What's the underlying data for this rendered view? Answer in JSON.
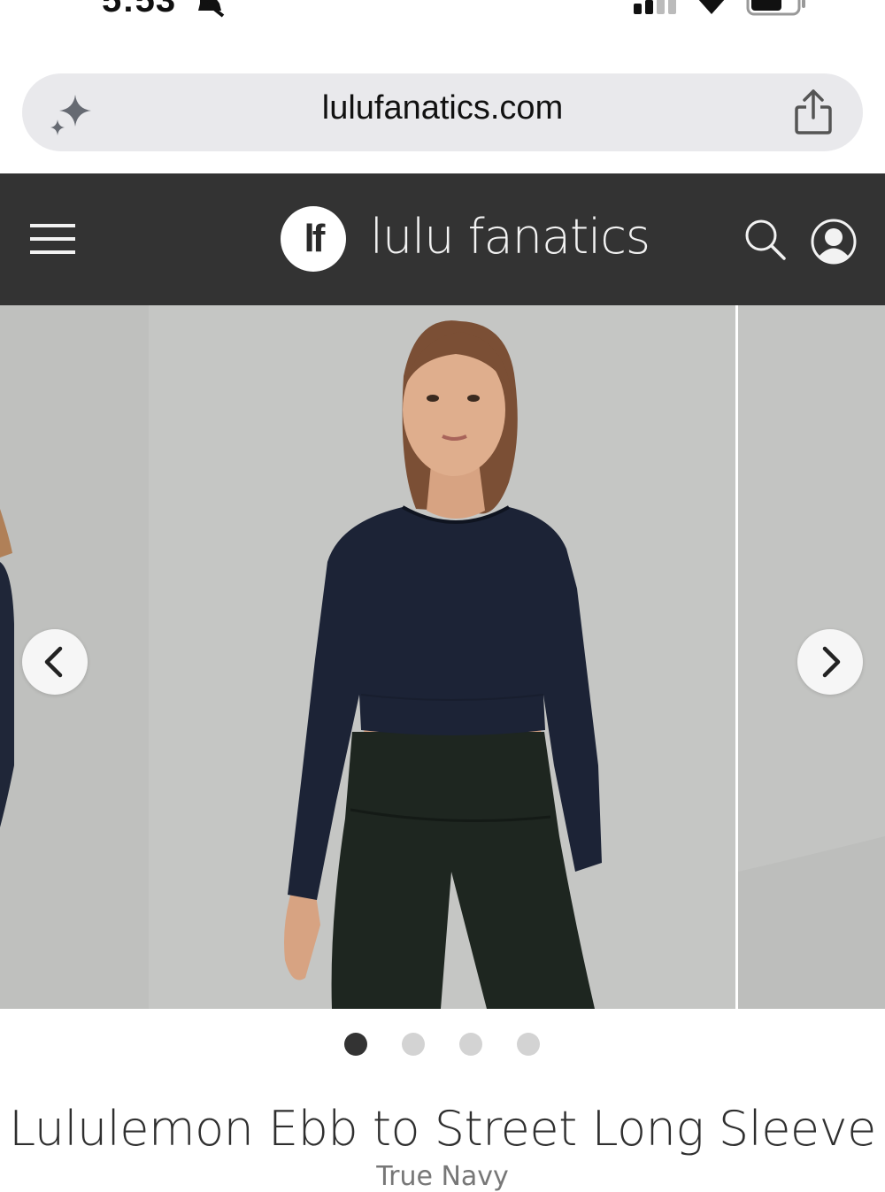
{
  "status_bar": {
    "time": "5:53",
    "icons": [
      "bell-slash-icon",
      "signal-icon",
      "wifi-icon",
      "battery-icon"
    ]
  },
  "browser": {
    "url": "lulufanatics.com",
    "left_icon": "sparkle-icon",
    "right_icon": "share-icon"
  },
  "site_header": {
    "logo_text": "lf",
    "brand_name": "lulu fanatics",
    "icons": [
      "hamburger-icon",
      "search-icon",
      "account-icon"
    ],
    "background": "#333333"
  },
  "carousel": {
    "prev_icon": "chevron-left-icon",
    "next_icon": "chevron-right-icon",
    "slide_count": 4,
    "active_index": 0,
    "image_subject": "model",
    "top_color": "#1c2336",
    "bottom_color": "#1e2620"
  },
  "product": {
    "title": "Lululemon Ebb to Street Long Sleeve",
    "color_name": "True Navy"
  }
}
